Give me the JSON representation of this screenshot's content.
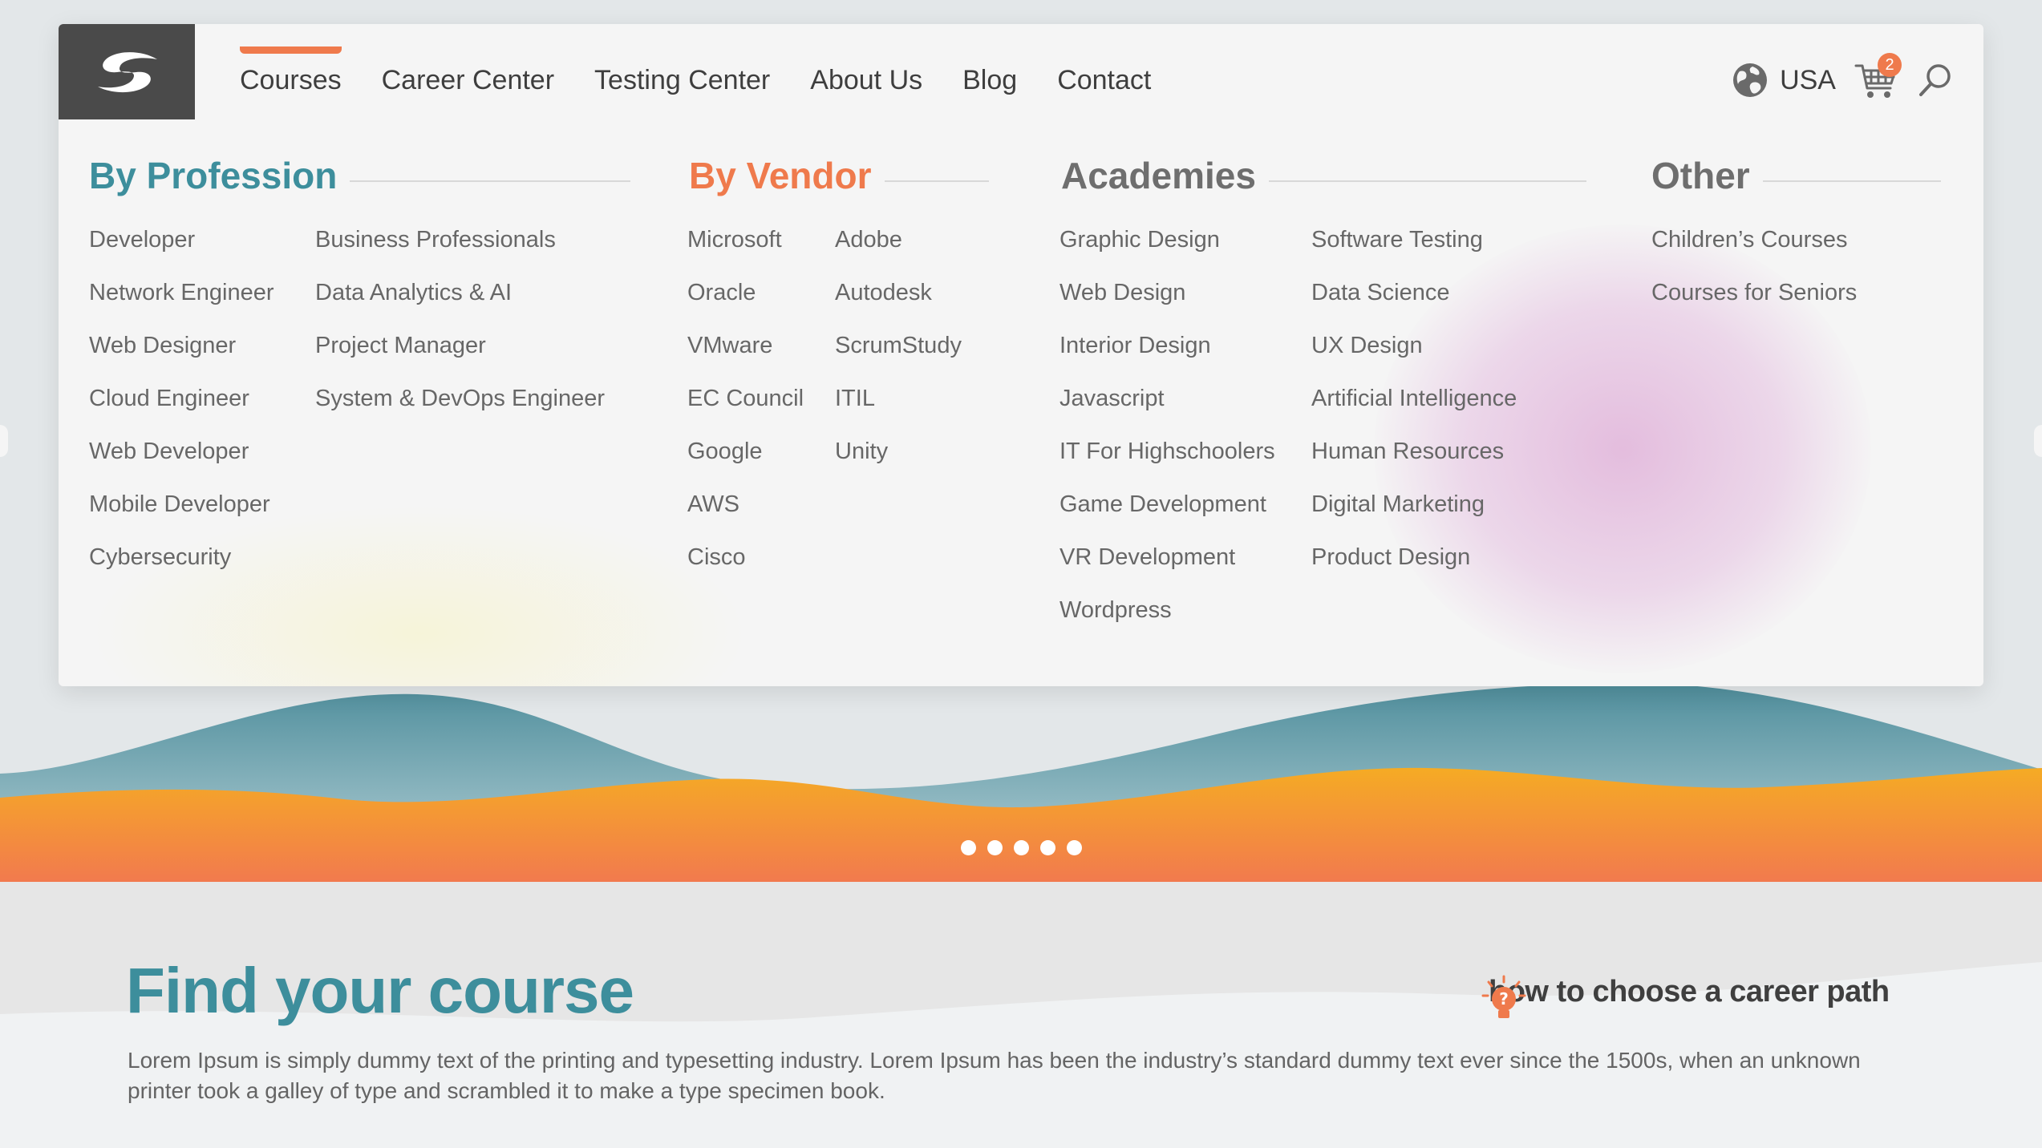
{
  "nav": {
    "items": [
      "Courses",
      "Career Center",
      "Testing Center",
      "About Us",
      "Blog",
      "Contact"
    ],
    "active_index": 0,
    "region": "USA",
    "cart_count": "2"
  },
  "menu": {
    "profession": {
      "heading": "By Profession",
      "col1": [
        "Developer",
        "Network Engineer",
        "Web Designer",
        "Cloud Engineer",
        "Web Developer",
        "Mobile Developer",
        "Cybersecurity"
      ],
      "col2": [
        "Business Professionals",
        "Data Analytics & AI",
        "Project Manager",
        "System & DevOps Engineer"
      ]
    },
    "vendor": {
      "heading": "By Vendor",
      "col1": [
        "Microsoft",
        "Oracle",
        "VMware",
        "EC Council",
        "Google",
        "AWS",
        "Cisco"
      ],
      "col2": [
        "Adobe",
        "Autodesk",
        "ScrumStudy",
        "ITIL",
        "Unity"
      ]
    },
    "academies": {
      "heading": "Academies",
      "col1": [
        "Graphic Design",
        "Web Design",
        "Interior Design",
        "Javascript",
        "IT For Highschoolers",
        "Game Development",
        "VR Development",
        "Wordpress"
      ],
      "col2": [
        "Software Testing",
        "Data Science",
        "UX Design",
        "Artificial Intelligence",
        "Human Resources",
        "Digital Marketing",
        "Product Design"
      ]
    },
    "other": {
      "heading": "Other",
      "col1": [
        "Children’s Courses",
        "Courses for Seniors"
      ]
    }
  },
  "carousel": {
    "slide_count": 5
  },
  "find": {
    "title": "Find your course",
    "description": "Lorem Ipsum is simply dummy text of the printing and typesetting industry. Lorem Ipsum has been the industry’s standard dummy text ever since the 1500s, when an unknown printer took a galley of type and scrambled it to make a type specimen book.",
    "career_link": "how to choose a career path"
  },
  "colors": {
    "teal": "#3d8e9c",
    "orange": "#ef7a4c",
    "gray_heading": "#6e6e6e",
    "logo_bg": "#4a4a4a"
  },
  "icons": [
    "logo-icon",
    "globe-icon",
    "cart-icon",
    "search-icon",
    "lightbulb-icon"
  ]
}
